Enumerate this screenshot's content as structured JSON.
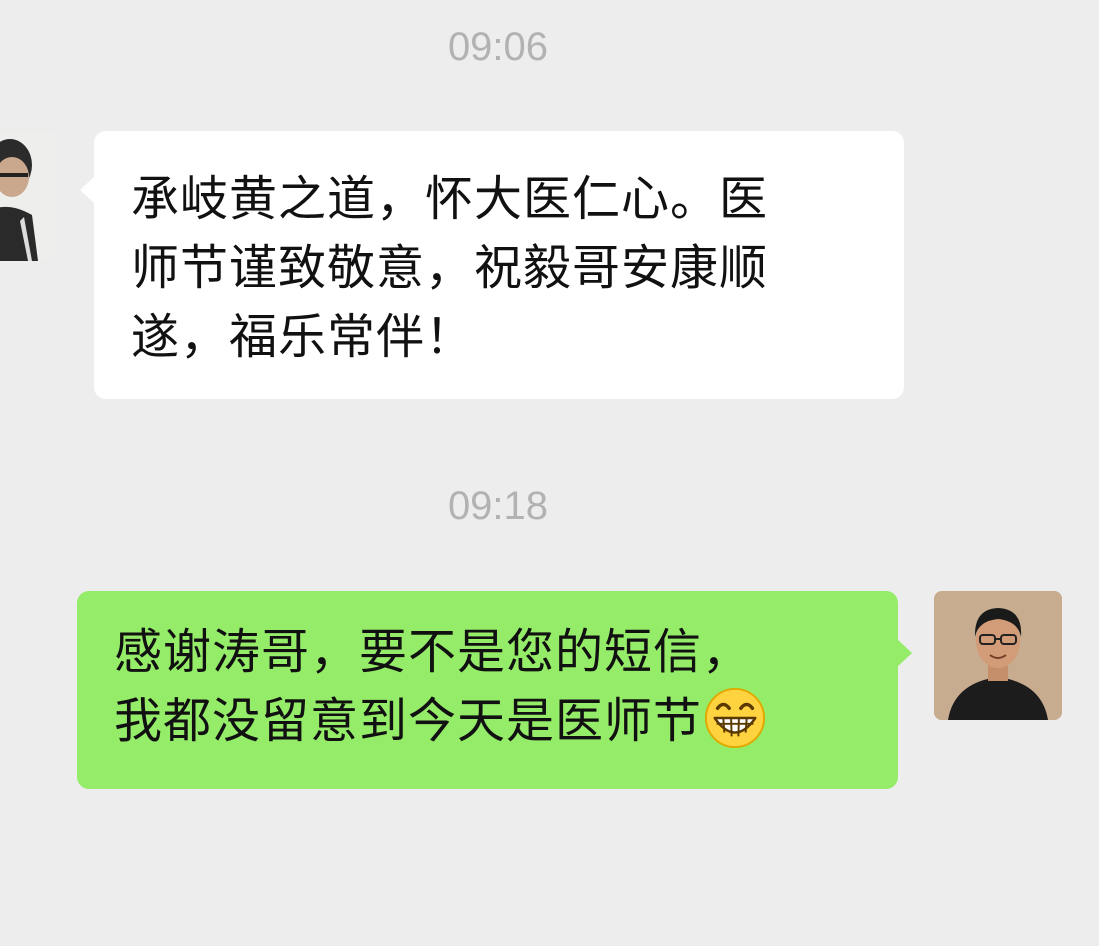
{
  "chat": {
    "timestamps": [
      "09:06",
      "09:18"
    ],
    "received_message": {
      "lines": [
        "承岐黄之道，怀大医仁心。医",
        "师节谨致敬意，祝毅哥安康顺",
        "遂，福乐常伴！"
      ]
    },
    "sent_message": {
      "lines": [
        "感谢涛哥，要不是您的短信，",
        "我都没留意到今天是医师节"
      ],
      "emoji": "grinning-face"
    }
  },
  "colors": {
    "background": "#ededed",
    "received_bubble": "#ffffff",
    "sent_bubble": "#95ec69",
    "timestamp_text": "#b2b2b2"
  }
}
